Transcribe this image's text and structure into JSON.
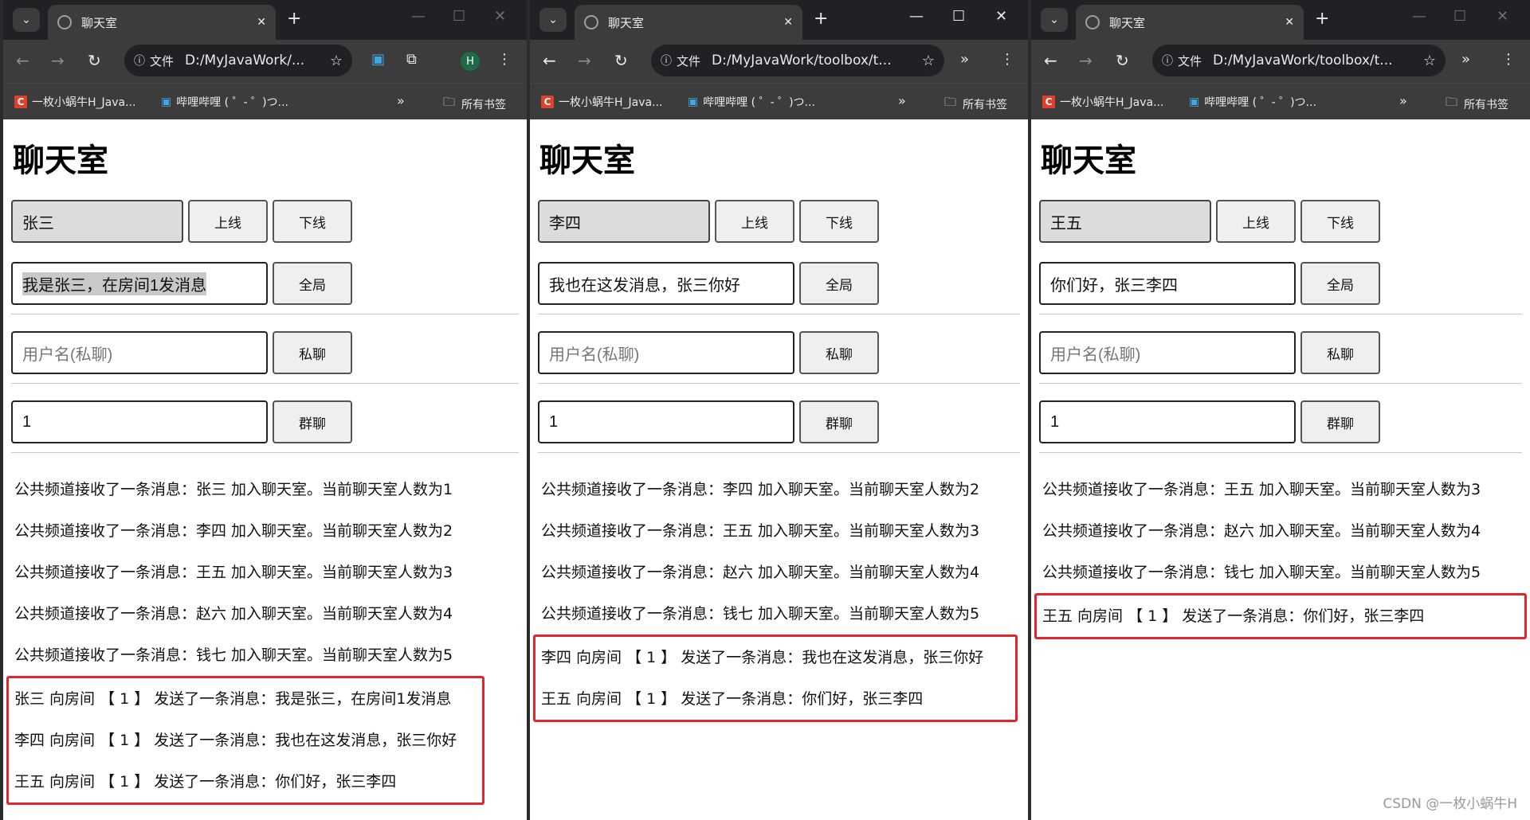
{
  "watermark": "CSDN @一枚小蜗牛H",
  "windows": [
    {
      "tab_title": "聊天室",
      "url_chip": "文件",
      "url": "D:/MyJavaWork/...",
      "profile_initial": "H",
      "bookmarks": [
        "一枚小蜗牛H_Java...",
        "哔哩哔哩 ( ゜- ゜)つ...",
        "所有书签"
      ],
      "heading": "聊天室",
      "username": "张三",
      "online_label": "上线",
      "offline_label": "下线",
      "message_value": "我是张三，在房间1发消息",
      "broadcast_label": "全局",
      "private_placeholder": "用户名(私聊)",
      "private_label": "私聊",
      "group_value": "1",
      "group_label": "群聊",
      "messages": [
        "公共频道接收了一条消息：张三 加入聊天室。当前聊天室人数为1",
        "公共频道接收了一条消息：李四 加入聊天室。当前聊天室人数为2",
        "公共频道接收了一条消息：王五 加入聊天室。当前聊天室人数为3",
        "公共频道接收了一条消息：赵六 加入聊天室。当前聊天室人数为4",
        "公共频道接收了一条消息：钱七 加入聊天室。当前聊天室人数为5"
      ],
      "room_messages": [
        "张三 向房间 【 1 】 发送了一条消息：我是张三，在房间1发消息",
        "李四 向房间 【 1 】 发送了一条消息：我也在这发消息，张三你好",
        "王五 向房间 【 1 】 发送了一条消息：你们好，张三李四"
      ]
    },
    {
      "tab_title": "聊天室",
      "url_chip": "文件",
      "url": "D:/MyJavaWork/toolbox/t...",
      "bookmarks": [
        "一枚小蜗牛H_Java...",
        "哔哩哔哩 ( ゜- ゜)つ...",
        "所有书签"
      ],
      "heading": "聊天室",
      "username": "李四",
      "online_label": "上线",
      "offline_label": "下线",
      "message_value": "我也在这发消息，张三你好",
      "broadcast_label": "全局",
      "private_placeholder": "用户名(私聊)",
      "private_label": "私聊",
      "group_value": "1",
      "group_label": "群聊",
      "messages": [
        "公共频道接收了一条消息：李四 加入聊天室。当前聊天室人数为2",
        "公共频道接收了一条消息：王五 加入聊天室。当前聊天室人数为3",
        "公共频道接收了一条消息：赵六 加入聊天室。当前聊天室人数为4",
        "公共频道接收了一条消息：钱七 加入聊天室。当前聊天室人数为5"
      ],
      "room_messages": [
        "李四 向房间 【 1 】 发送了一条消息：我也在这发消息，张三你好",
        "王五 向房间 【 1 】 发送了一条消息：你们好，张三李四"
      ]
    },
    {
      "tab_title": "聊天室",
      "url_chip": "文件",
      "url": "D:/MyJavaWork/toolbox/t...",
      "bookmarks": [
        "一枚小蜗牛H_Java...",
        "哔哩哔哩 ( ゜- ゜)つ...",
        "所有书签"
      ],
      "heading": "聊天室",
      "username": "王五",
      "online_label": "上线",
      "offline_label": "下线",
      "message_value": "你们好，张三李四",
      "broadcast_label": "全局",
      "private_placeholder": "用户名(私聊)",
      "private_label": "私聊",
      "group_value": "1",
      "group_label": "群聊",
      "messages": [
        "公共频道接收了一条消息：王五 加入聊天室。当前聊天室人数为3",
        "公共频道接收了一条消息：赵六 加入聊天室。当前聊天室人数为4",
        "公共频道接收了一条消息：钱七 加入聊天室。当前聊天室人数为5"
      ],
      "room_messages": [
        "王五 向房间 【 1 】 发送了一条消息：你们好，张三李四"
      ]
    }
  ]
}
